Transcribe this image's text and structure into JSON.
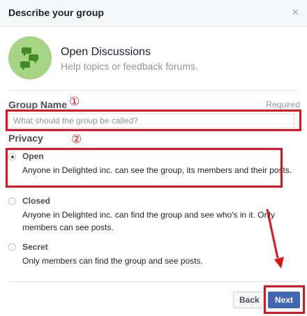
{
  "dialog": {
    "title": "Describe your group",
    "close_glyph": "×"
  },
  "group_type": {
    "icon": "chat-bubbles-icon",
    "title": "Open Discussions",
    "description": "Help topics or feedback forums."
  },
  "group_name": {
    "label": "Group Name",
    "required": "Required",
    "placeholder": "What should the group be called?",
    "value": ""
  },
  "privacy": {
    "label": "Privacy",
    "options": [
      {
        "title": "Open",
        "description": "Anyone in Delighted inc. can see the group, its members and their posts.",
        "selected": true
      },
      {
        "title": "Closed",
        "description": "Anyone in Delighted inc. can find the group and see who's in it. Only members can see posts.",
        "selected": false
      },
      {
        "title": "Secret",
        "description": "Only members can find the group and see posts.",
        "selected": false
      }
    ]
  },
  "footer": {
    "back_label": "Back",
    "next_label": "Next"
  },
  "annotations": {
    "marker_1": "①",
    "marker_2": "②",
    "highlight_color": "#e0141f"
  },
  "colors": {
    "accent": "#4267b2",
    "icon_circle": "#a6d485",
    "icon_bubble": "#3f8a24"
  }
}
